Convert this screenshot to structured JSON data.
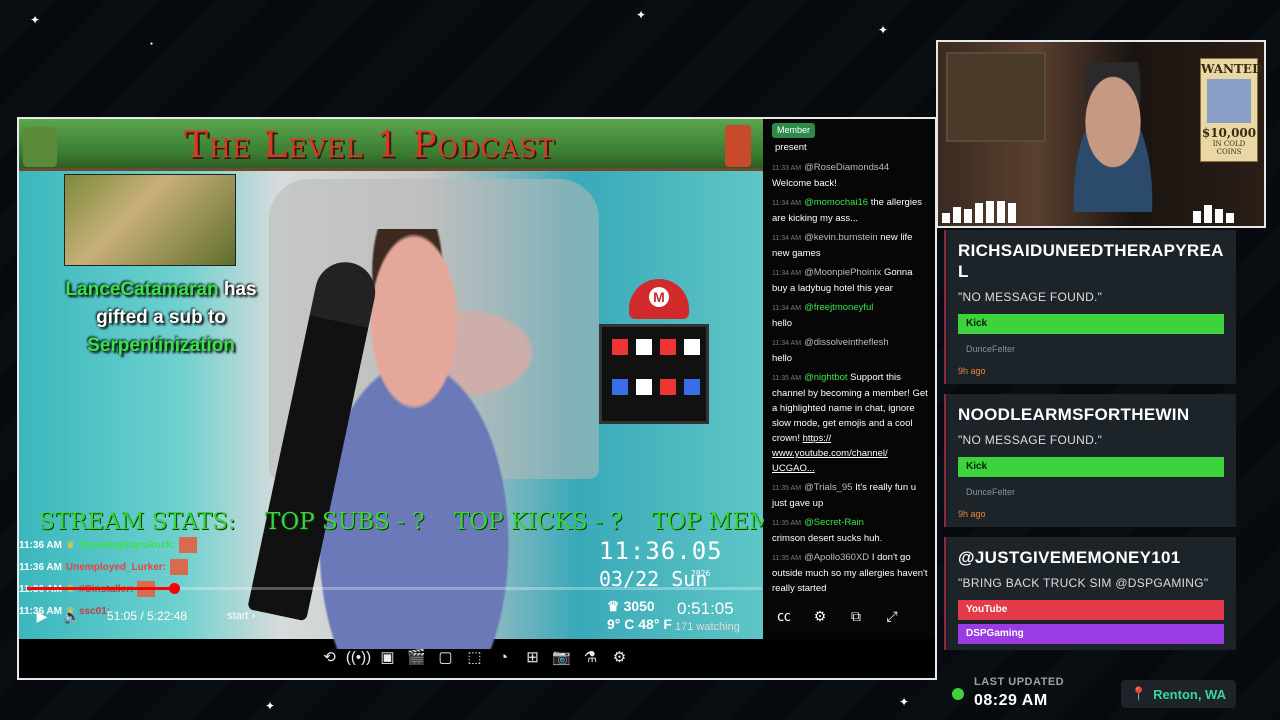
{
  "banner": {
    "title": "The Level 1 Podcast"
  },
  "gift_alert": {
    "gifter": "LanceCatamaran",
    "middle1": "has",
    "middle2": "gifted a sub to",
    "recipient": "Serpentinization"
  },
  "stream_stats": [
    "STREAM STATS:",
    "TOP SUBS - ?",
    "TOP KICKS - ?",
    "TOP MEMBERS!"
  ],
  "events": [
    {
      "time": "11:36 AM",
      "user": "ShootingStarsRock:"
    },
    {
      "time": "11:36 AM",
      "user": "Unemployed_Lurker:"
    },
    {
      "time": "11:36 AM",
      "user": "#Cinstaller:"
    },
    {
      "time": "11:36 AM",
      "user": "ssc01:"
    }
  ],
  "clock": {
    "time": "11:36.05",
    "year": "2026",
    "date": "03/22 Sun"
  },
  "weather": {
    "viewers": "3050",
    "temp": "9° C 48° F"
  },
  "player": {
    "timecode": "51:05 / 5:22:48",
    "chapter": "start",
    "live_time": "0:51:05",
    "watching": "171 watching",
    "progress": 0.2
  },
  "chat": {
    "tag": "Member",
    "messages": [
      {
        "ts": "",
        "user": "",
        "text": "present"
      },
      {
        "ts": "11:33 AM",
        "user": "@RoseDiamonds44",
        "text": "Welcome back!"
      },
      {
        "ts": "11:34 AM",
        "user": "@momochai16",
        "text": "the allergies are kicking my ass..."
      },
      {
        "ts": "11:34 AM",
        "user": "@kevin.burnstein",
        "text": "new life new games"
      },
      {
        "ts": "11:34 AM",
        "user": "@MoonpiePhoinix",
        "text": "Gonna buy a ladybug hotel this year"
      },
      {
        "ts": "11:34 AM",
        "user": "@freejtmoneyful",
        "text": "hello"
      },
      {
        "ts": "11:34 AM",
        "user": "@dissolveintheflesh",
        "text": "hello"
      },
      {
        "ts": "11:35 AM",
        "user": "@nightbot",
        "text": "Support this channel by becoming a member! Get a highlighted name in chat, ignore slow mode, get emojis and a cool crown!",
        "link": "https:// www.youtube.com/channel/ UCGAO..."
      },
      {
        "ts": "11:35 AM",
        "user": "@Trials_95",
        "text": "It's really fun u just gave up"
      },
      {
        "ts": "11:35 AM",
        "user": "@Secret-Rain",
        "text": "crimson desert sucks huh."
      },
      {
        "ts": "11:35 AM",
        "user": "@Apollo360XD",
        "text": "I don't go outside much so my allergies haven't really started"
      }
    ]
  },
  "webcam": {
    "wanted": "WANTED",
    "amount": "$10,000",
    "sub": "IN COLD COINS"
  },
  "cards": [
    {
      "title": "RICHSAIDUNEEDTHERAPYREAL",
      "message": "\"NO MESSAGE FOUND.\"",
      "badge": "Kick",
      "channel": "DunceFelter",
      "ago": "9h ago"
    },
    {
      "title": "NOODLEARMSFORTHEWIN",
      "message": "\"NO MESSAGE FOUND.\"",
      "badge": "Kick",
      "channel": "DunceFelter",
      "ago": "9h ago"
    },
    {
      "title": "@JUSTGIVEMEMONEY101",
      "message": "\"BRING BACK TRUCK SIM @DSPGAMING\"",
      "badge": "YouTube",
      "badge2": "DSPGaming"
    }
  ],
  "footer": {
    "label": "LAST UPDATED",
    "value": "08:29 AM",
    "location": "Renton, WA"
  },
  "colors": {
    "kick": "#3cd33c",
    "youtube": "#e33b4a",
    "purple": "#9a3be3",
    "stats_green": "#3ad43e"
  }
}
